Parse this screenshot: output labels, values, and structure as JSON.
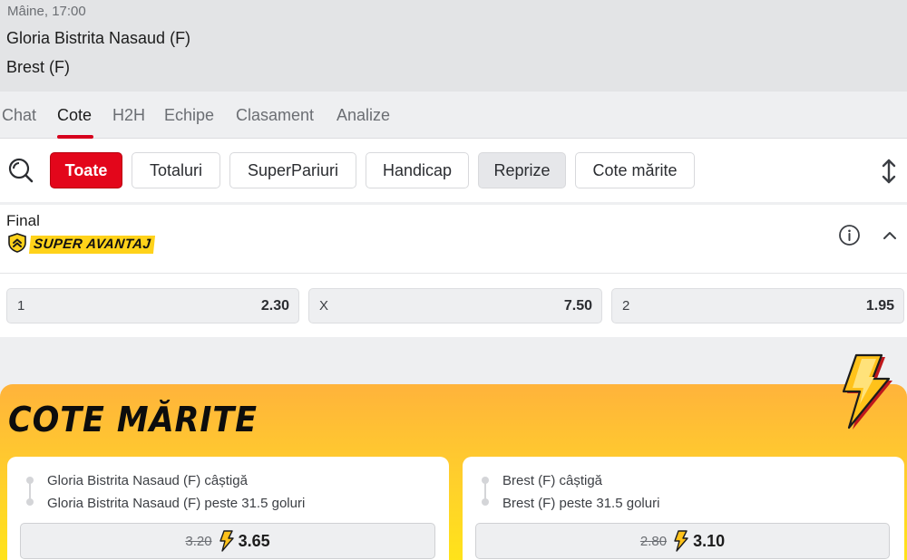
{
  "match": {
    "time": "Mâine, 17:00",
    "home": "Gloria Bistrita Nasaud (F)",
    "away": "Brest (F)"
  },
  "tabs": [
    {
      "label": "Chat",
      "active": false
    },
    {
      "label": "Cote",
      "active": true
    },
    {
      "label": "H2H",
      "active": false
    },
    {
      "label": "Echipe",
      "active": false
    },
    {
      "label": "Clasament",
      "active": false
    },
    {
      "label": "Analize",
      "active": false
    }
  ],
  "filters": [
    {
      "label": "Toate",
      "state": "selected"
    },
    {
      "label": "Totaluri",
      "state": "default"
    },
    {
      "label": "SuperPariuri",
      "state": "default"
    },
    {
      "label": "Handicap",
      "state": "default"
    },
    {
      "label": "Reprize",
      "state": "hover"
    },
    {
      "label": "Cote mărite",
      "state": "default"
    }
  ],
  "icons": {
    "search": "search-icon",
    "expand": "expand-vertical-icon",
    "info": "info-icon",
    "collapse": "chevron-up-icon",
    "shield": "shield-chevron-icon",
    "bolt": "lightning-bolt-icon"
  },
  "market": {
    "title": "Final",
    "badge": "SUPER AVANTAJ",
    "odds": [
      {
        "label": "1",
        "value": "2.30"
      },
      {
        "label": "X",
        "value": "7.50"
      },
      {
        "label": "2",
        "value": "1.95"
      }
    ]
  },
  "boost": {
    "title": "COTE MĂRITE",
    "cards": [
      {
        "selections": [
          "Gloria Bistrita Nasaud (F) câștigă",
          "Gloria Bistrita Nasaud (F) peste 31.5 goluri"
        ],
        "old_odd": "3.20",
        "new_odd": "3.65"
      },
      {
        "selections": [
          "Brest (F) câștigă",
          "Brest (F) peste 31.5 goluri"
        ],
        "old_odd": "2.80",
        "new_odd": "3.10"
      }
    ]
  },
  "colors": {
    "accent_red": "#e3061b",
    "boost_yellow": "#ffd22a",
    "boost_orange": "#ffb33b"
  }
}
